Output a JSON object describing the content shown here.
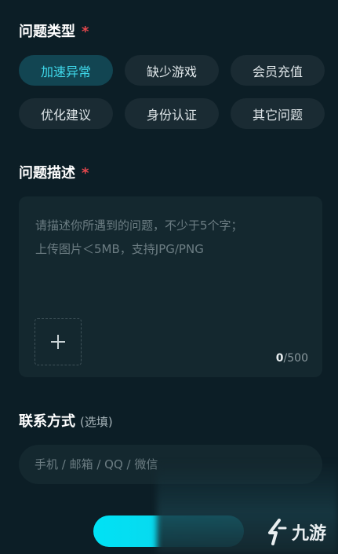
{
  "issue_type": {
    "title": "问题类型",
    "required_mark": "*",
    "options": [
      {
        "label": "加速异常",
        "active": true
      },
      {
        "label": "缺少游戏",
        "active": false
      },
      {
        "label": "会员充值",
        "active": false
      },
      {
        "label": "优化建议",
        "active": false
      },
      {
        "label": "身份认证",
        "active": false
      },
      {
        "label": "其它问题",
        "active": false
      }
    ]
  },
  "description": {
    "title": "问题描述",
    "required_mark": "*",
    "placeholder_line1": "请描述你所遇到的问题，不少于5个字；",
    "placeholder_line2": "上传图片＜5MB，支持JPG/PNG",
    "upload_icon": "plus-icon",
    "count_current": "0",
    "count_max": "/500"
  },
  "contact": {
    "title": "联系方式",
    "optional_hint": "(选填)",
    "placeholder": "手机 / 邮箱 / QQ / 微信"
  },
  "watermark": {
    "text": "九游"
  },
  "colors": {
    "background": "#0c1e26",
    "accent": "#3fd8ea",
    "required": "#e5484d",
    "submit": "#00e2f5"
  }
}
